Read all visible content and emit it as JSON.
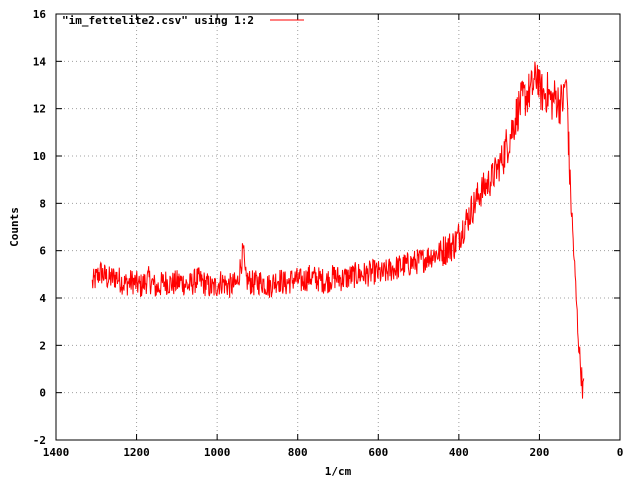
{
  "chart_data": {
    "type": "line",
    "title": "",
    "xlabel": "1/cm",
    "ylabel": "Counts",
    "xlim": [
      1400,
      0
    ],
    "ylim": [
      -2,
      16
    ],
    "x_reversed": true,
    "grid": true,
    "legend_position": "top-left",
    "x_ticks": [
      1400,
      1200,
      1000,
      800,
      600,
      400,
      200,
      0
    ],
    "y_ticks": [
      -2,
      0,
      2,
      4,
      6,
      8,
      10,
      12,
      14,
      16
    ],
    "colors": {
      "series": "#ff0000",
      "grid": "#a0a0a0",
      "frame": "#000000"
    },
    "series": [
      {
        "name": "\"im_fettelite2.csv\" using 1:2",
        "color": "#ff0000",
        "x": [
          1310,
          1290,
          1270,
          1250,
          1230,
          1210,
          1190,
          1170,
          1150,
          1130,
          1110,
          1090,
          1070,
          1050,
          1030,
          1010,
          990,
          970,
          950,
          935,
          930,
          910,
          890,
          870,
          850,
          830,
          810,
          790,
          770,
          750,
          730,
          710,
          690,
          670,
          650,
          630,
          610,
          590,
          570,
          550,
          530,
          510,
          490,
          470,
          450,
          430,
          410,
          395,
          380,
          370,
          360,
          350,
          340,
          330,
          320,
          310,
          300,
          290,
          280,
          270,
          260,
          250,
          240,
          230,
          220,
          210,
          205,
          200,
          190,
          180,
          170,
          160,
          150,
          140,
          135,
          130,
          128,
          125,
          120,
          115,
          110,
          105,
          100,
          95,
          92,
          90
        ],
        "y": [
          4.6,
          5.1,
          4.8,
          4.9,
          4.6,
          4.7,
          4.5,
          4.8,
          4.4,
          4.7,
          4.6,
          4.7,
          4.5,
          4.8,
          4.6,
          4.4,
          4.7,
          4.5,
          4.6,
          6.0,
          4.8,
          4.6,
          4.7,
          4.5,
          4.8,
          4.6,
          4.8,
          4.7,
          4.9,
          4.8,
          4.7,
          4.9,
          4.8,
          4.9,
          5.0,
          5.0,
          5.1,
          5.0,
          5.2,
          5.3,
          5.4,
          5.5,
          5.6,
          5.8,
          5.9,
          6.1,
          6.3,
          6.8,
          7.3,
          7.7,
          8.0,
          8.4,
          8.6,
          8.8,
          9.0,
          9.3,
          9.6,
          10.0,
          10.5,
          11.0,
          11.6,
          12.1,
          12.4,
          12.6,
          12.8,
          13.2,
          13.6,
          12.8,
          12.6,
          12.7,
          12.3,
          12.5,
          12.2,
          12.4,
          13.3,
          12.0,
          10.8,
          9.2,
          7.6,
          6.0,
          4.4,
          2.8,
          1.5,
          0.6,
          0.1,
          0.6
        ]
      }
    ]
  }
}
